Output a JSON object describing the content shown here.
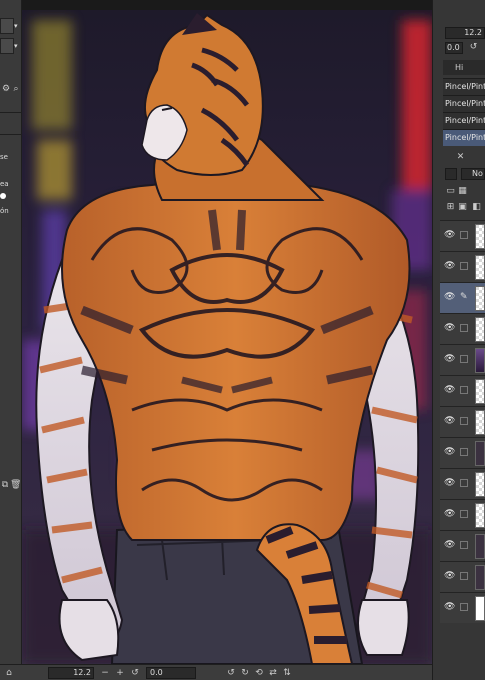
{
  "left_panel": {
    "labels": [
      "se",
      "ea",
      "ón"
    ]
  },
  "right_panel": {
    "zoom_value": "12.2",
    "angle_value": "0.0",
    "tab_label": "Hi",
    "brushes": [
      {
        "label": "Pincel/Pintura"
      },
      {
        "label": "Pincel/Pintura"
      },
      {
        "label": "Pincel/Pintura"
      },
      {
        "label": "Pincel/Pintura"
      }
    ],
    "blend_mode": "No",
    "layers": [
      {
        "thumb": "checker",
        "active": false
      },
      {
        "thumb": "checker",
        "active": false
      },
      {
        "thumb": "checker",
        "active": true
      },
      {
        "thumb": "checker",
        "active": false
      },
      {
        "thumb": "photo",
        "active": false
      },
      {
        "thumb": "checker",
        "active": false
      },
      {
        "thumb": "checker",
        "active": false
      },
      {
        "thumb": "dark",
        "active": false
      },
      {
        "thumb": "checker",
        "active": false
      },
      {
        "thumb": "checker",
        "active": false
      },
      {
        "thumb": "dark",
        "active": false
      },
      {
        "thumb": "dark",
        "active": false
      },
      {
        "thumb": "white",
        "active": false
      }
    ]
  },
  "status_bar": {
    "zoom_value": "12.2",
    "angle_value": "0.0"
  },
  "colors": {
    "fur_orange": "#d9782e",
    "stripe": "#2a1d2e",
    "neon_purple": "#7a4fd0",
    "neon_red": "#e0303a",
    "neon_yellow": "#e8d040",
    "selection_blue": "#4a5a78"
  }
}
